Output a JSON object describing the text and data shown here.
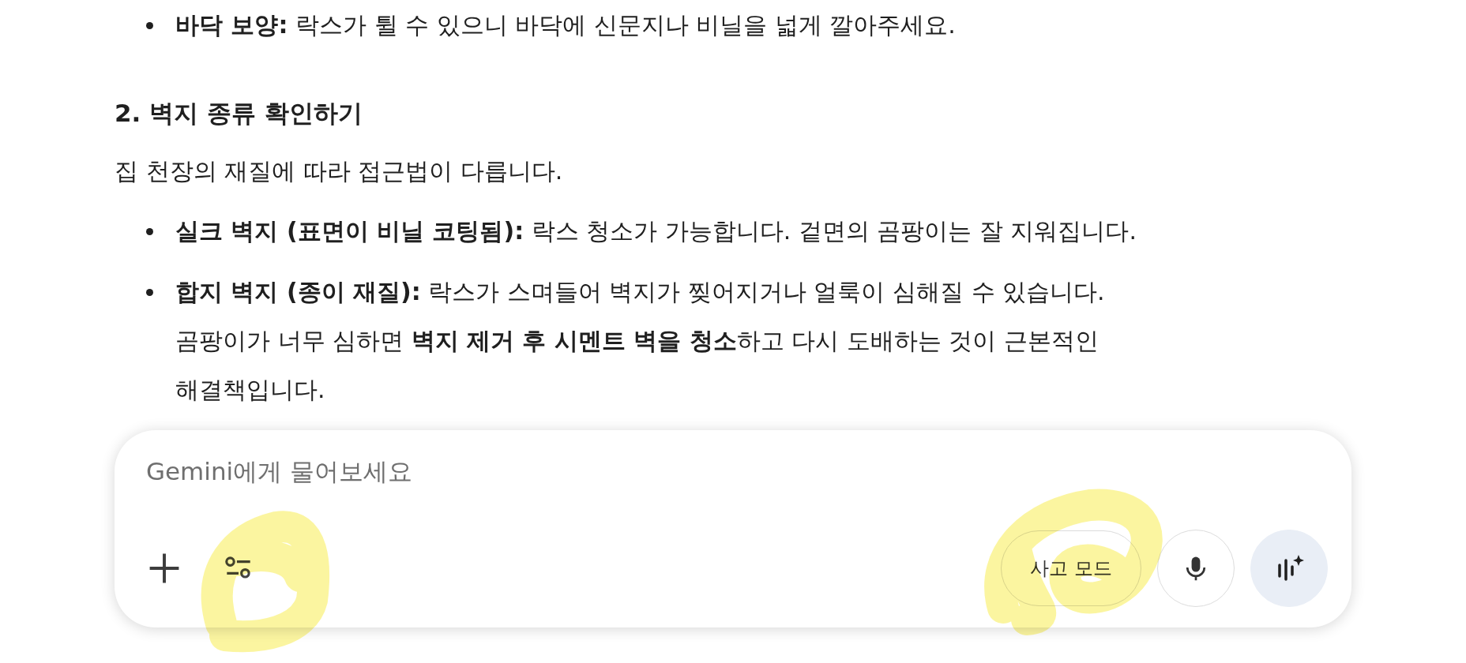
{
  "top_bullets": [
    "**바닥 보양:** 락스가 튈 수 있으니 바닥에 신문지나 비닐을 넓게 깔아주세요."
  ],
  "heading": "2. 벽지 종류 확인하기",
  "intro": "집 천장의 재질에 따라 접근법이 다릅니다.",
  "bullets": [
    "**실크 벽지 (표면이 비닐 코팅됨):** 락스 청소가 가능합니다. 겉면의 곰팡이는 잘 지워집니다.",
    [
      "**합지 벽지 (종이 재질):** 락스가 스며들어 벽지가 찢어지거나 얼룩이 심해질 수 있습니다.",
      "곰팡이가 너무 심하면 **벽지 제거 후 시멘트 벽을 청소**하고 다시 도배하는 것이 근본적인",
      "해결책입니다."
    ]
  ],
  "composer": {
    "placeholder": "Gemini에게 물어보세요",
    "mode_button": "사고 모드"
  }
}
